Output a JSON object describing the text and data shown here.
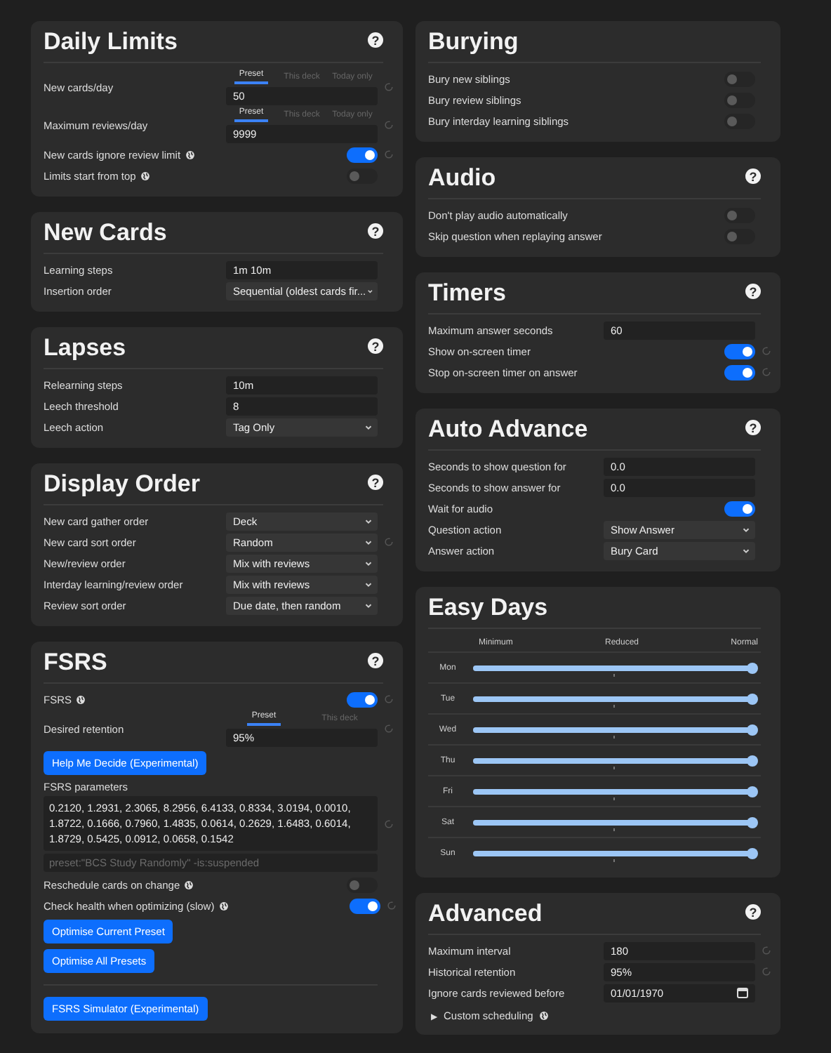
{
  "columns": [
    {
      "sections": [
        {
          "title": "Daily Limits",
          "help": "?",
          "rows": [
            {
              "kind": "spin",
              "label": "New cards/day",
              "tabs": [
                {
                  "label": "Preset",
                  "selected": true
                },
                {
                  "label": "This deck",
                  "selected": false
                },
                {
                  "label": "Today only",
                  "selected": false
                }
              ],
              "value": "50",
              "revert": true
            },
            {
              "kind": "spin",
              "label": "Maximum reviews/day",
              "tabs": [
                {
                  "label": "Preset",
                  "selected": true
                },
                {
                  "label": "This deck",
                  "selected": false
                },
                {
                  "label": "Today only",
                  "selected": false
                }
              ],
              "value": "9999",
              "revert": true
            },
            {
              "kind": "toggle",
              "label": "New cards ignore review limit",
              "globe": true,
              "on": true,
              "revert": true
            },
            {
              "kind": "toggle",
              "label": "Limits start from top",
              "globe": true,
              "on": false,
              "revert": false
            }
          ]
        },
        {
          "title": "New Cards",
          "help": "?",
          "rows": [
            {
              "kind": "text",
              "label": "Learning steps",
              "value": "1m 10m",
              "revert": false
            },
            {
              "kind": "select",
              "label": "Insertion order",
              "value": "Sequential (oldest cards fir...",
              "revert": false
            }
          ]
        },
        {
          "title": "Lapses",
          "help": "?",
          "rows": [
            {
              "kind": "text",
              "label": "Relearning steps",
              "value": "10m",
              "revert": false
            },
            {
              "kind": "text",
              "label": "Leech threshold",
              "value": "8",
              "revert": false
            },
            {
              "kind": "select",
              "label": "Leech action",
              "value": "Tag Only",
              "revert": false
            }
          ]
        },
        {
          "title": "Display Order",
          "help": "?",
          "rows": [
            {
              "kind": "select",
              "label": "New card gather order",
              "value": "Deck",
              "revert": false
            },
            {
              "kind": "select",
              "label": "New card sort order",
              "value": "Random",
              "revert": true
            },
            {
              "kind": "select",
              "label": "New/review order",
              "value": "Mix with reviews",
              "revert": false
            },
            {
              "kind": "select",
              "label": "Interday learning/review order",
              "value": "Mix with reviews",
              "revert": false
            },
            {
              "kind": "select",
              "label": "Review sort order",
              "value": "Due date, then random",
              "revert": false
            }
          ]
        },
        {
          "title": "FSRS",
          "help": "?",
          "rows": [
            {
              "kind": "toggle",
              "label": "FSRS",
              "globe": true,
              "on": true,
              "revert": true
            },
            {
              "kind": "spin",
              "label": "Desired retention",
              "tabs": [
                {
                  "label": "Preset",
                  "selected": true
                },
                {
                  "label": "This deck",
                  "selected": false
                }
              ],
              "value": "95%",
              "revert": true
            },
            {
              "kind": "button",
              "label": "Help Me Decide (Experimental)"
            },
            {
              "kind": "params",
              "label": "FSRS parameters",
              "value": "0.2120, 1.2931, 2.3065, 8.2956, 6.4133, 0.8334, 3.0194, 0.0010, 1.8722, 0.1666, 0.7960, 1.4835, 0.0614, 0.2629, 1.6483, 0.6014, 1.8729, 0.5425, 0.0912, 0.0658, 0.1542",
              "revert": true
            },
            {
              "kind": "search",
              "placeholder": "preset:\"BCS Study Randomly\" -is:suspended"
            },
            {
              "kind": "toggle",
              "label": "Reschedule cards on change",
              "globe": true,
              "on": false,
              "revert": false
            },
            {
              "kind": "toggle",
              "label": "Check health when optimizing (slow)",
              "globe": true,
              "on": true,
              "revert": true
            },
            {
              "kind": "button",
              "label": "Optimise Current Preset"
            },
            {
              "kind": "button",
              "label": "Optimise All Presets"
            },
            {
              "kind": "divider"
            },
            {
              "kind": "button",
              "label": "FSRS Simulator (Experimental)"
            }
          ]
        }
      ]
    },
    {
      "sections": [
        {
          "title": "Burying",
          "rows": [
            {
              "kind": "toggle",
              "label": "Bury new siblings",
              "globe": false,
              "on": false,
              "revert": false
            },
            {
              "kind": "toggle",
              "label": "Bury review siblings",
              "globe": false,
              "on": false,
              "revert": false
            },
            {
              "kind": "toggle",
              "label": "Bury interday learning siblings",
              "globe": false,
              "on": false,
              "revert": false
            }
          ]
        },
        {
          "title": "Audio",
          "help": "?",
          "rows": [
            {
              "kind": "toggle",
              "label": "Don't play audio automatically",
              "globe": false,
              "on": false,
              "revert": false
            },
            {
              "kind": "toggle",
              "label": "Skip question when replaying answer",
              "globe": false,
              "on": false,
              "revert": false
            }
          ]
        },
        {
          "title": "Timers",
          "help": "?",
          "rows": [
            {
              "kind": "text",
              "label": "Maximum answer seconds",
              "value": "60",
              "revert": false
            },
            {
              "kind": "toggle",
              "label": "Show on-screen timer",
              "globe": false,
              "on": true,
              "revert": true
            },
            {
              "kind": "toggle",
              "label": "Stop on-screen timer on answer",
              "globe": false,
              "on": true,
              "revert": true
            }
          ]
        },
        {
          "title": "Auto Advance",
          "help": "?",
          "rows": [
            {
              "kind": "text",
              "label": "Seconds to show question for",
              "value": "0.0",
              "revert": false
            },
            {
              "kind": "text",
              "label": "Seconds to show answer for",
              "value": "0.0",
              "revert": false
            },
            {
              "kind": "toggle",
              "label": "Wait for audio",
              "globe": false,
              "on": true,
              "revert": false
            },
            {
              "kind": "select",
              "label": "Question action",
              "value": "Show Answer",
              "revert": false
            },
            {
              "kind": "select",
              "label": "Answer action",
              "value": "Bury Card",
              "revert": false
            }
          ]
        },
        {
          "title": "Easy Days",
          "rows": [
            {
              "kind": "scale",
              "labels": [
                "Minimum",
                "Reduced",
                "Normal"
              ]
            },
            {
              "kind": "day",
              "label": "Mon",
              "level": 1
            },
            {
              "kind": "day",
              "label": "Tue",
              "level": 1
            },
            {
              "kind": "day",
              "label": "Wed",
              "level": 1
            },
            {
              "kind": "day",
              "label": "Thu",
              "level": 1
            },
            {
              "kind": "day",
              "label": "Fri",
              "level": 1
            },
            {
              "kind": "day",
              "label": "Sat",
              "level": 1
            },
            {
              "kind": "day",
              "label": "Sun",
              "level": 1
            }
          ]
        },
        {
          "title": "Advanced",
          "help": "?",
          "rows": [
            {
              "kind": "text",
              "label": "Maximum interval",
              "value": "180",
              "revert": true
            },
            {
              "kind": "text",
              "label": "Historical retention",
              "value": "95%",
              "revert": true
            },
            {
              "kind": "date",
              "label": "Ignore cards reviewed before",
              "value": "01/01/1970",
              "revert": false
            },
            {
              "kind": "details",
              "marker": "▶",
              "label": "Custom scheduling",
              "globe": true
            }
          ]
        }
      ]
    }
  ]
}
